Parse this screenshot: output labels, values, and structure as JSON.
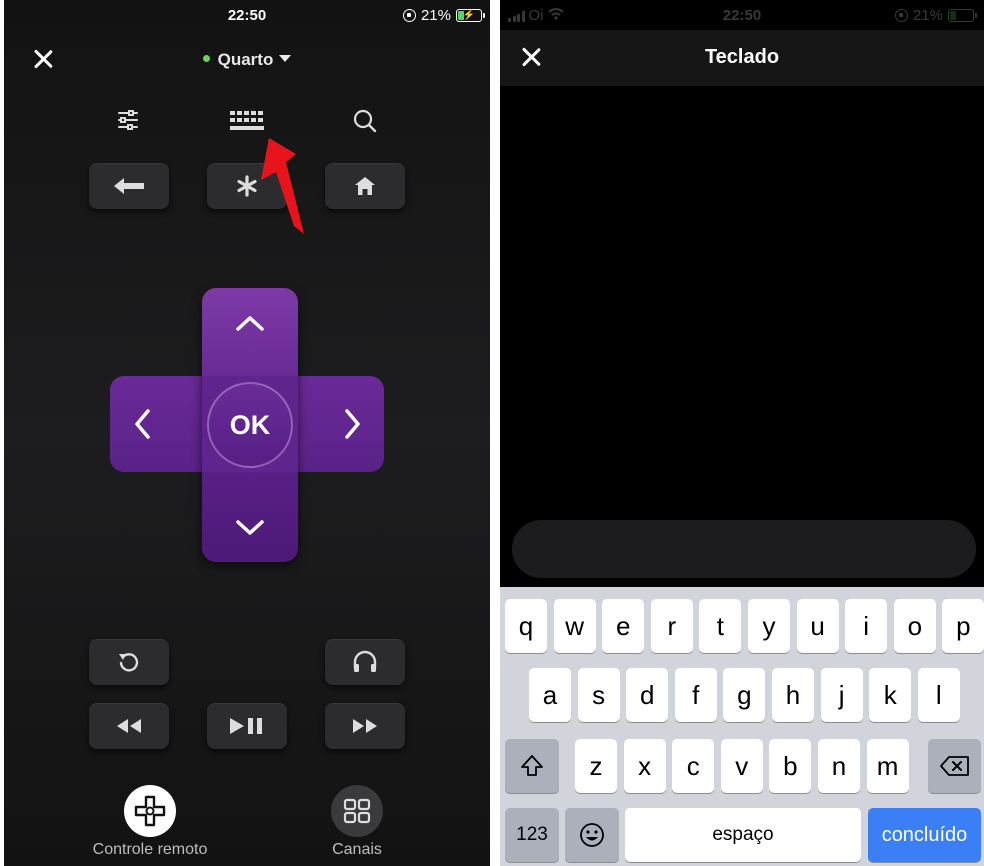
{
  "left": {
    "status": {
      "time": "22:50",
      "battery": "21%"
    },
    "device": {
      "name": "Quarto",
      "status_color": "#6bd25b"
    },
    "toolbar": {
      "settings_icon": "sliders-icon",
      "keyboard_icon": "keyboard-icon",
      "search_icon": "search-icon"
    },
    "dpad": {
      "ok_label": "OK",
      "accent": "#5e228c"
    },
    "bottom_nav": {
      "remote_label": "Controle remoto",
      "channels_label": "Canais"
    },
    "annotation_arrow_color": "#e8141b"
  },
  "right": {
    "status": {
      "carrier": "Oi",
      "time": "22:50",
      "battery": "21%"
    },
    "title": "Teclado",
    "keyboard": {
      "row1": [
        "q",
        "w",
        "e",
        "r",
        "t",
        "y",
        "u",
        "i",
        "o",
        "p"
      ],
      "row2": [
        "a",
        "s",
        "d",
        "f",
        "g",
        "h",
        "j",
        "k",
        "l"
      ],
      "row3": [
        "z",
        "x",
        "c",
        "v",
        "b",
        "n",
        "m"
      ],
      "numbers_label": "123",
      "space_label": "espaço",
      "done_label": "concluído",
      "done_color": "#3b7ff6"
    }
  }
}
